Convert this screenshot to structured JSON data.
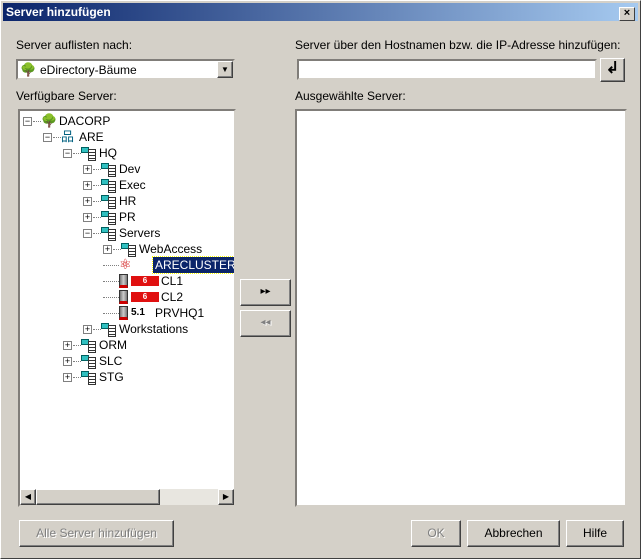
{
  "window": {
    "title": "Server hinzufügen",
    "close": "×"
  },
  "left": {
    "list_by_label": "Server auflisten nach:",
    "combo_value": "eDirectory-Bäume",
    "available_label": "Verfügbare Server:"
  },
  "right": {
    "host_label": "Server über den Hostnamen bzw. die IP-Adresse hinzufügen:",
    "host_value": "",
    "enter_glyph": "↲",
    "selected_label": "Ausgewählte Server:"
  },
  "tree": [
    {
      "label": "DACORP",
      "level": 0,
      "icon": "tree",
      "exp": "-"
    },
    {
      "label": "ARE",
      "level": 1,
      "icon": "org",
      "exp": "-"
    },
    {
      "label": "HQ",
      "level": 2,
      "icon": "ou",
      "exp": "-"
    },
    {
      "label": "Dev",
      "level": 3,
      "icon": "ou",
      "exp": "+"
    },
    {
      "label": "Exec",
      "level": 3,
      "icon": "ou",
      "exp": "+"
    },
    {
      "label": "HR",
      "level": 3,
      "icon": "ou",
      "exp": "+"
    },
    {
      "label": "PR",
      "level": 3,
      "icon": "ou",
      "exp": "+"
    },
    {
      "label": "Servers",
      "level": 3,
      "icon": "ou",
      "exp": "-"
    },
    {
      "label": "WebAccess",
      "level": 4,
      "icon": "ou",
      "exp": "+"
    },
    {
      "label": "ARECLUSTER",
      "level": 4,
      "icon": "cluster",
      "exp": "",
      "selected": true
    },
    {
      "label": "CL1",
      "level": 4,
      "icon": "server",
      "exp": "",
      "badge": "6"
    },
    {
      "label": "CL2",
      "level": 4,
      "icon": "server",
      "exp": "",
      "badge": "6"
    },
    {
      "label": "PRVHQ1",
      "level": 4,
      "icon": "server",
      "exp": "",
      "version": "5.1"
    },
    {
      "label": "Workstations",
      "level": 3,
      "icon": "ou",
      "exp": "+"
    },
    {
      "label": "ORM",
      "level": 2,
      "icon": "ou",
      "exp": "+"
    },
    {
      "label": "SLC",
      "level": 2,
      "icon": "ou",
      "exp": "+"
    },
    {
      "label": "STG",
      "level": 2,
      "icon": "ou",
      "exp": "+"
    }
  ],
  "buttons": {
    "add": "▸▸",
    "remove": "◂◂",
    "add_all": "Alle Server hinzufügen",
    "ok": "OK",
    "cancel": "Abbrechen",
    "help": "Hilfe"
  },
  "colors": {
    "title_bar": "#0a246a",
    "selection": "#0a246a",
    "face": "#d4d0c8"
  }
}
